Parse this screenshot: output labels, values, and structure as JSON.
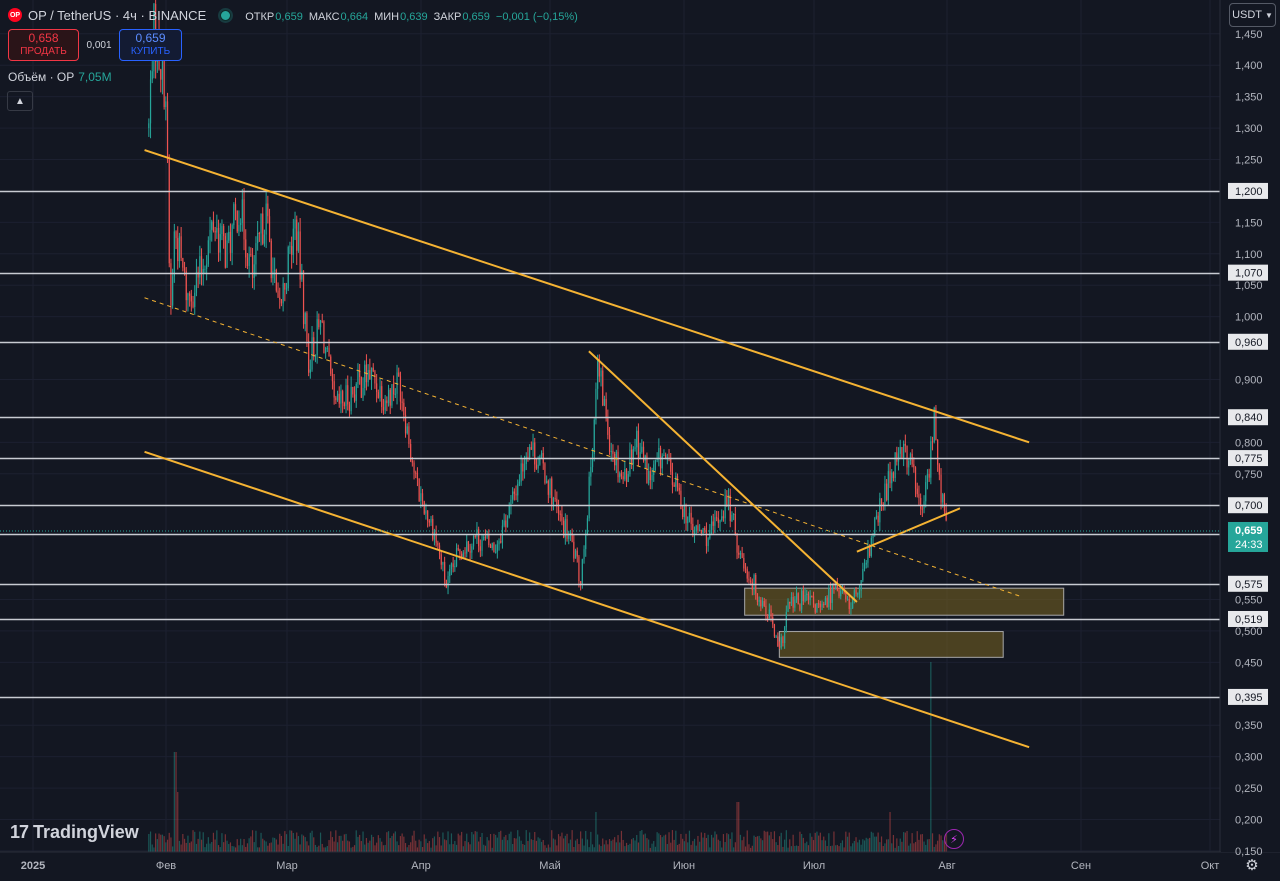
{
  "header": {
    "symbol": "OP / TetherUS · 4ч · BINANCE",
    "logo_text": "OP",
    "ohlc": [
      {
        "k": "ОТКР",
        "v": "0,659"
      },
      {
        "k": "МАКС",
        "v": "0,664"
      },
      {
        "k": "МИН",
        "v": "0,639"
      },
      {
        "k": "ЗАКР",
        "v": "0,659"
      },
      {
        "k": "",
        "v": "−0,001 (−0,15%)"
      }
    ]
  },
  "trade": {
    "sell_price": "0,658",
    "sell_label": "ПРОДАТЬ",
    "spread": "0,001",
    "buy_price": "0,659",
    "buy_label": "КУПИТЬ"
  },
  "volume": {
    "label": "Объём · OP",
    "value": "7,05M"
  },
  "currency_button": "USDT",
  "branding": {
    "name": "TradingView"
  },
  "colors": {
    "background": "#131722",
    "up": "#26a69a",
    "down": "#ef5350",
    "trendline": "#f5b333",
    "level_line": "#c8cbd2",
    "zone_fill": "#7a6420"
  },
  "chart_data": {
    "type": "candlestick",
    "timeframe": "4ч",
    "y_axis": {
      "ticks": [
        "1,450",
        "1,400",
        "1,350",
        "1,300",
        "1,250",
        "1,150",
        "1,100",
        "1,050",
        "1,000",
        "0,900",
        "0,800",
        "0,750",
        "0,550",
        "0,500",
        "0,450",
        "0,350",
        "0,300",
        "0,250",
        "0,200",
        "0,150"
      ],
      "ylim": [
        0.12,
        1.52
      ]
    },
    "x_axis": {
      "ticks": [
        "2025",
        "Фев",
        "Мар",
        "Апр",
        "Май",
        "Июн",
        "Июл",
        "Авг",
        "Сен",
        "Окт"
      ]
    },
    "current_price": {
      "value": "0,659",
      "countdown": "24:33"
    },
    "horizontal_levels": [
      {
        "value": 1.2,
        "label": "1,200"
      },
      {
        "value": 1.07,
        "label": "1,070"
      },
      {
        "value": 0.96,
        "label": "0,960"
      },
      {
        "value": 0.84,
        "label": "0,840"
      },
      {
        "value": 0.775,
        "label": "0,775"
      },
      {
        "value": 0.7,
        "label": "0,700"
      },
      {
        "value": 0.655,
        "label": "0,655"
      },
      {
        "value": 0.575,
        "label": "0,575"
      },
      {
        "value": 0.519,
        "label": "0,519"
      },
      {
        "value": 0.395,
        "label": "0,395"
      }
    ],
    "trendlines": [
      {
        "name": "upper-channel",
        "from": [
          "2025-01-27",
          1.265
        ],
        "to": [
          "2025-08-20",
          0.8
        ],
        "style": "solid"
      },
      {
        "name": "lower-channel",
        "from": [
          "2025-01-27",
          0.785
        ],
        "to": [
          "2025-08-20",
          0.315
        ],
        "style": "solid"
      },
      {
        "name": "mid-channel",
        "from": [
          "2025-01-27",
          1.03
        ],
        "to": [
          "2025-08-18",
          0.555
        ],
        "style": "dashed"
      },
      {
        "name": "may-downtrend",
        "from": [
          "2025-05-10",
          0.945
        ],
        "to": [
          "2025-07-11",
          0.546
        ],
        "style": "solid"
      },
      {
        "name": "july-support",
        "from": [
          "2025-07-11",
          0.626
        ],
        "to": [
          "2025-08-04",
          0.695
        ],
        "style": "solid"
      }
    ],
    "zones": [
      {
        "from": "2025-06-15",
        "to": "2025-08-28",
        "low": 0.525,
        "high": 0.568
      },
      {
        "from": "2025-06-23",
        "to": "2025-08-14",
        "low": 0.458,
        "high": 0.499
      }
    ],
    "price_path": [
      [
        "2025-01-28",
        1.3
      ],
      [
        "2025-01-29",
        1.46
      ],
      [
        "2025-01-31",
        1.4
      ],
      [
        "2025-02-01",
        1.35
      ],
      [
        "2025-02-02",
        0.99
      ],
      [
        "2025-02-03",
        1.14
      ],
      [
        "2025-02-06",
        1.03
      ],
      [
        "2025-02-09",
        1.07
      ],
      [
        "2025-02-12",
        1.15
      ],
      [
        "2025-02-15",
        1.1
      ],
      [
        "2025-02-18",
        1.18
      ],
      [
        "2025-02-21",
        1.06
      ],
      [
        "2025-02-24",
        1.17
      ],
      [
        "2025-02-27",
        1.0
      ],
      [
        "2025-03-03",
        1.15
      ],
      [
        "2025-03-06",
        0.93
      ],
      [
        "2025-03-09",
        0.99
      ],
      [
        "2025-03-12",
        0.85
      ],
      [
        "2025-03-16",
        0.88
      ],
      [
        "2025-03-20",
        0.91
      ],
      [
        "2025-03-24",
        0.87
      ],
      [
        "2025-03-27",
        0.9
      ],
      [
        "2025-03-31",
        0.73
      ],
      [
        "2025-04-04",
        0.66
      ],
      [
        "2025-04-07",
        0.57
      ],
      [
        "2025-04-10",
        0.63
      ],
      [
        "2025-04-14",
        0.65
      ],
      [
        "2025-04-18",
        0.63
      ],
      [
        "2025-04-22",
        0.7
      ],
      [
        "2025-04-26",
        0.8
      ],
      [
        "2025-04-30",
        0.75
      ],
      [
        "2025-05-03",
        0.68
      ],
      [
        "2025-05-06",
        0.64
      ],
      [
        "2025-05-08",
        0.58
      ],
      [
        "2025-05-10",
        0.72
      ],
      [
        "2025-05-12",
        0.92
      ],
      [
        "2025-05-15",
        0.8
      ],
      [
        "2025-05-18",
        0.74
      ],
      [
        "2025-05-21",
        0.81
      ],
      [
        "2025-05-24",
        0.74
      ],
      [
        "2025-05-27",
        0.78
      ],
      [
        "2025-05-30",
        0.73
      ],
      [
        "2025-06-03",
        0.66
      ],
      [
        "2025-06-07",
        0.65
      ],
      [
        "2025-06-11",
        0.71
      ],
      [
        "2025-06-14",
        0.62
      ],
      [
        "2025-06-18",
        0.56
      ],
      [
        "2025-06-21",
        0.52
      ],
      [
        "2025-06-23",
        0.46
      ],
      [
        "2025-06-25",
        0.54
      ],
      [
        "2025-06-29",
        0.55
      ],
      [
        "2025-07-03",
        0.53
      ],
      [
        "2025-07-06",
        0.58
      ],
      [
        "2025-07-09",
        0.54
      ],
      [
        "2025-07-12",
        0.57
      ],
      [
        "2025-07-15",
        0.66
      ],
      [
        "2025-07-18",
        0.73
      ],
      [
        "2025-07-21",
        0.8
      ],
      [
        "2025-07-24",
        0.76
      ],
      [
        "2025-07-26",
        0.68
      ],
      [
        "2025-07-28",
        0.77
      ],
      [
        "2025-07-29",
        0.84
      ],
      [
        "2025-07-30",
        0.75
      ],
      [
        "2025-08-01",
        0.659
      ]
    ]
  }
}
